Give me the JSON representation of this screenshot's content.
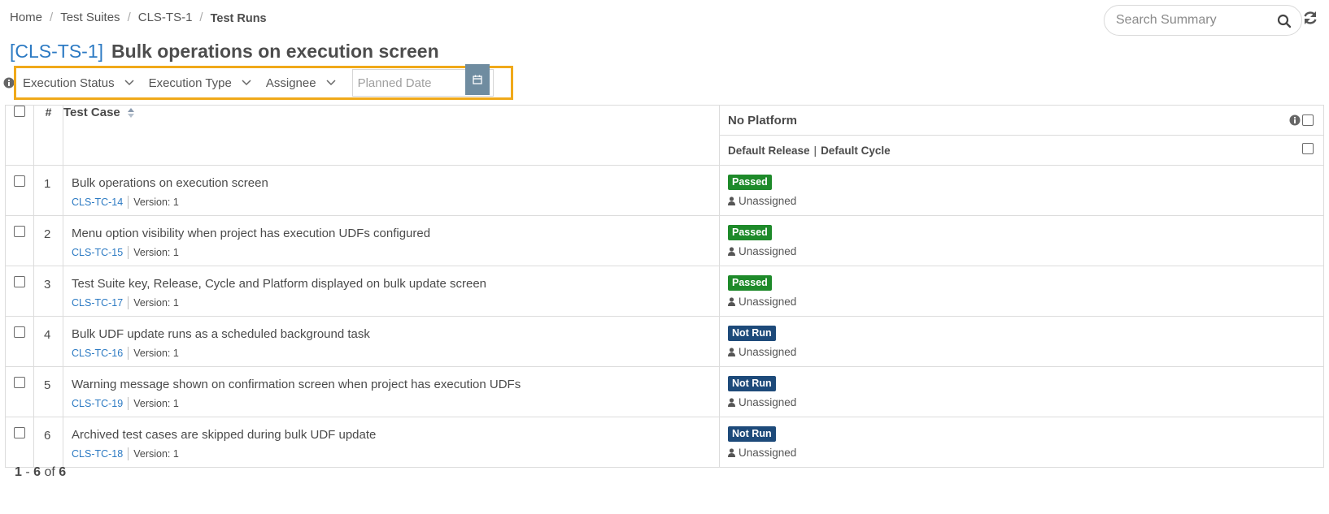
{
  "breadcrumb": {
    "items": [
      "Home",
      "Test Suites",
      "CLS-TS-1"
    ],
    "separator": "/",
    "current": "Test Runs"
  },
  "search": {
    "placeholder": "Search Summary",
    "value": ""
  },
  "icons": {
    "search": "search-icon",
    "refresh": "refresh-icon",
    "calendar": "calendar-icon",
    "info": "info-icon",
    "user": "user-icon",
    "sort": "sort-icon",
    "chevron": "chevron-down-icon"
  },
  "title": {
    "key": "[CLS-TS-1]",
    "text": "Bulk operations on execution screen"
  },
  "filters": {
    "execution_status": "Execution Status",
    "execution_type": "Execution Type",
    "assignee": "Assignee",
    "planned_date_placeholder": "Planned Date"
  },
  "table": {
    "headers": {
      "number": "#",
      "test_case": "Test Case",
      "platform": "No Platform",
      "release": "Default Release",
      "cycle": "Default Cycle",
      "release_separator": "|"
    },
    "rows": [
      {
        "num": "1",
        "title": "Bulk operations on execution screen",
        "key": "CLS-TC-14",
        "version": "Version: 1",
        "status": "Passed",
        "assignee": "Unassigned"
      },
      {
        "num": "2",
        "title": "Menu option visibility when project has execution UDFs configured",
        "key": "CLS-TC-15",
        "version": "Version: 1",
        "status": "Passed",
        "assignee": "Unassigned"
      },
      {
        "num": "3",
        "title": "Test Suite key, Release, Cycle and Platform displayed on bulk update screen",
        "key": "CLS-TC-17",
        "version": "Version: 1",
        "status": "Passed",
        "assignee": "Unassigned"
      },
      {
        "num": "4",
        "title": "Bulk UDF update runs as a scheduled background task",
        "key": "CLS-TC-16",
        "version": "Version: 1",
        "status": "Not Run",
        "assignee": "Unassigned"
      },
      {
        "num": "5",
        "title": "Warning message shown on confirmation screen when project has execution UDFs",
        "key": "CLS-TC-19",
        "version": "Version: 1",
        "status": "Not Run",
        "assignee": "Unassigned"
      },
      {
        "num": "6",
        "title": "Archived test cases are skipped during bulk UDF update",
        "key": "CLS-TC-18",
        "version": "Version: 1",
        "status": "Not Run",
        "assignee": "Unassigned"
      }
    ]
  },
  "pager": {
    "start": "1",
    "dash": "-",
    "end": "6",
    "of": "of",
    "total": "6"
  },
  "colors": {
    "accent": "#2c7ac3",
    "highlight": "#f0a91a",
    "passed": "#1e8a2a",
    "not_run": "#1d4a7a",
    "calendar_button": "#6f8ca0"
  }
}
